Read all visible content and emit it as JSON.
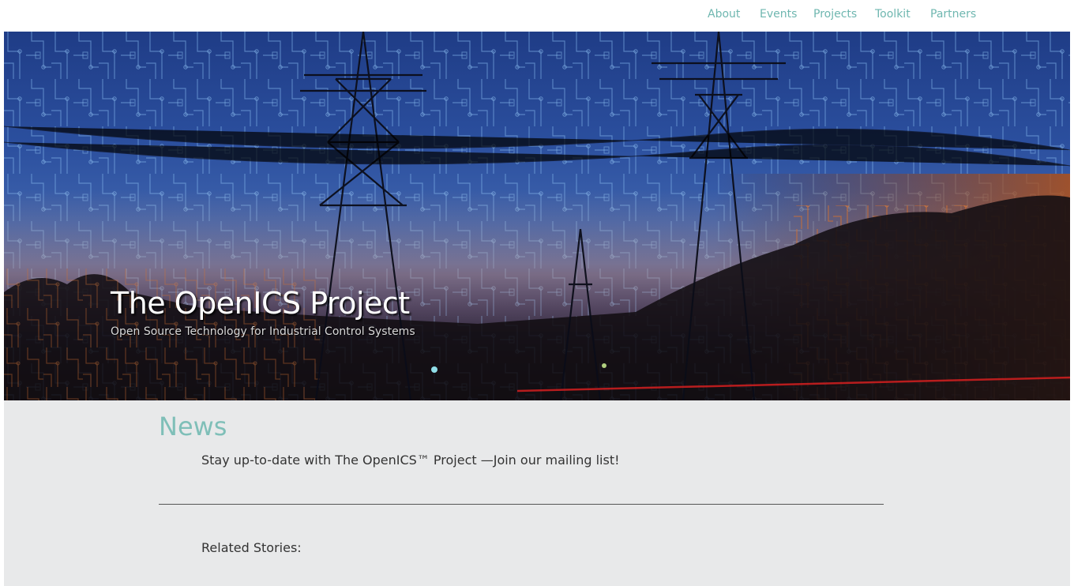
{
  "nav": {
    "items": [
      {
        "label": "About"
      },
      {
        "label": "Events"
      },
      {
        "label": "Projects"
      },
      {
        "label": "Toolkit"
      },
      {
        "label": "Partners"
      }
    ]
  },
  "hero": {
    "title": "The OpenICS Project",
    "subtitle": "Open Source Technology for Industrial Control Systems"
  },
  "news": {
    "heading": "News",
    "mailing_text": "Stay up-to-date with The OpenICS™ Project —Join our mailing list!",
    "related_label": "Related Stories:"
  },
  "colors": {
    "nav_link": "#6fb7b0",
    "news_heading": "#7fbfb8",
    "content_bg": "#e8e9ea",
    "body_text": "#333333"
  }
}
